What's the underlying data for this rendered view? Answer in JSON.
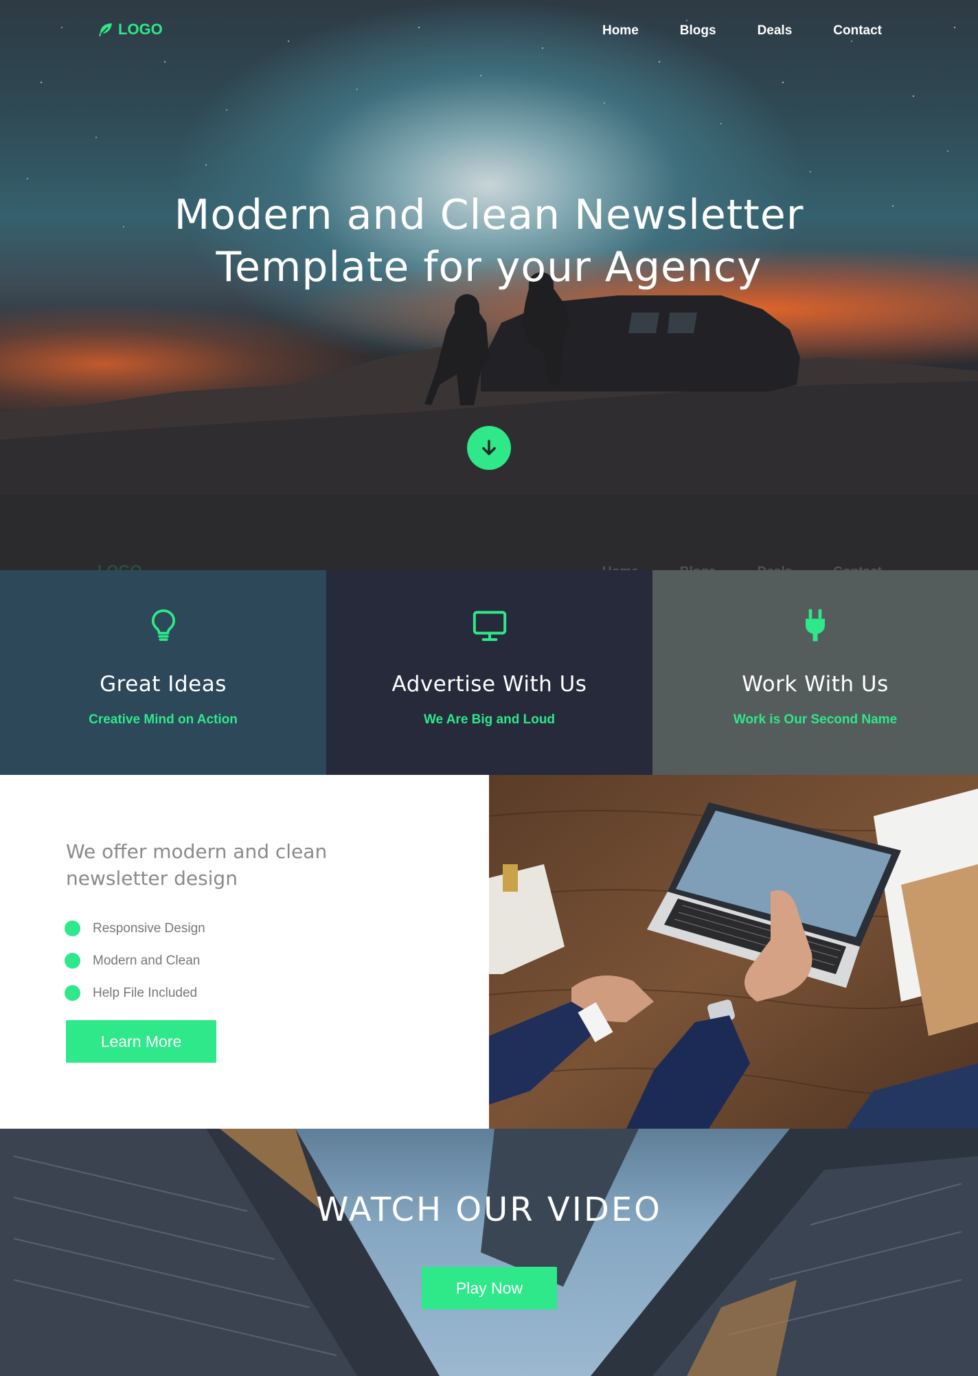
{
  "nav": {
    "logo_text": "LOGO",
    "items": [
      {
        "label": "Home"
      },
      {
        "label": "Blogs"
      },
      {
        "label": "Deals"
      },
      {
        "label": "Contact"
      }
    ]
  },
  "hero": {
    "title_line1": "Modern and Clean Newsletter",
    "title_line2": "Template for your Agency",
    "scroll_icon": "arrow-down-icon"
  },
  "features": [
    {
      "icon": "lightbulb-icon",
      "title": "Great Ideas",
      "subtitle": "Creative Mind on Action"
    },
    {
      "icon": "monitor-icon",
      "title": "Advertise With Us",
      "subtitle": "We Are Big and Loud"
    },
    {
      "icon": "plug-icon",
      "title": "Work With Us",
      "subtitle": "Work is Our Second Name"
    }
  ],
  "offer": {
    "heading": "We offer modern and clean newsletter design",
    "items": [
      "Responsive Design",
      "Modern and Clean",
      "Help File Included"
    ],
    "button_label": "Learn More"
  },
  "video": {
    "heading": "WATCH OUR VIDEO",
    "button_label": "Play Now"
  },
  "colors": {
    "accent": "#2ee88a",
    "feature1_bg": "#2c4859",
    "feature2_bg": "#262a3b",
    "feature3_bg": "#555d5c"
  }
}
